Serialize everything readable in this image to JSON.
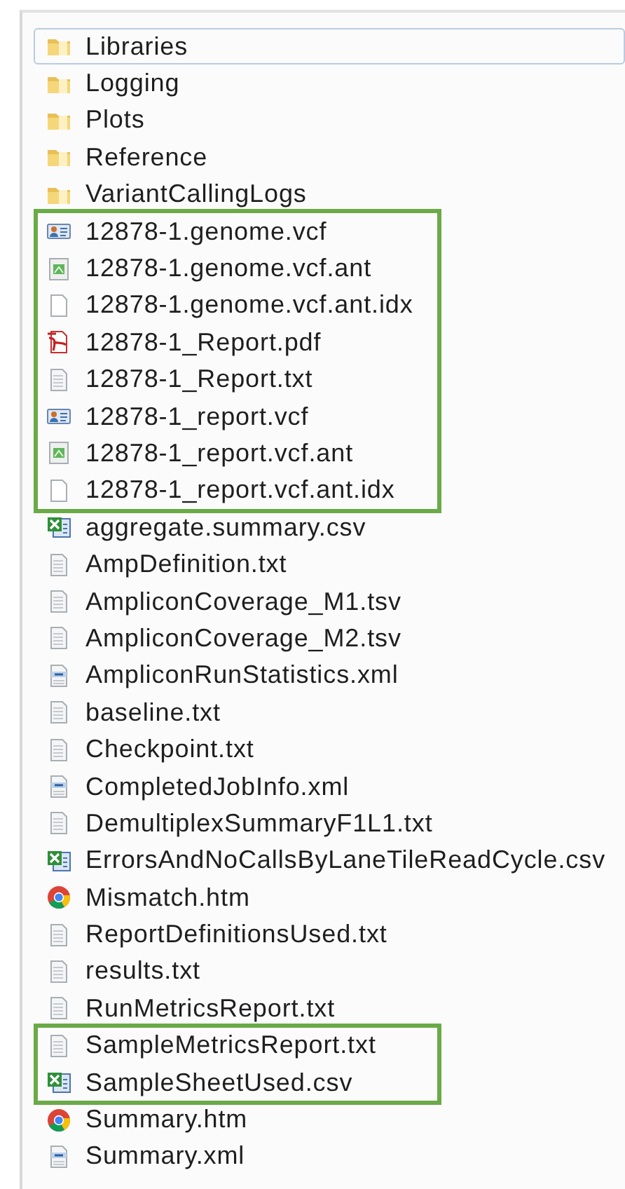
{
  "files": [
    {
      "highlighted": false,
      "items": [
        {
          "name": "Libraries",
          "kind": "folder",
          "focused": true
        },
        {
          "name": "Logging",
          "kind": "folder",
          "focused": false
        },
        {
          "name": "Plots",
          "kind": "folder",
          "focused": false
        },
        {
          "name": "Reference",
          "kind": "folder",
          "focused": false
        },
        {
          "name": "VariantCallingLogs",
          "kind": "folder",
          "focused": false
        }
      ]
    },
    {
      "highlighted": true,
      "items": [
        {
          "name": "12878-1.genome.vcf",
          "kind": "vcf",
          "focused": false
        },
        {
          "name": "12878-1.genome.vcf.ant",
          "kind": "ant",
          "focused": false
        },
        {
          "name": "12878-1.genome.vcf.ant.idx",
          "kind": "blank",
          "focused": false
        },
        {
          "name": "12878-1_Report.pdf",
          "kind": "pdf",
          "focused": false
        },
        {
          "name": "12878-1_Report.txt",
          "kind": "txt",
          "focused": false
        },
        {
          "name": "12878-1_report.vcf",
          "kind": "vcf",
          "focused": false
        },
        {
          "name": "12878-1_report.vcf.ant",
          "kind": "ant",
          "focused": false
        },
        {
          "name": "12878-1_report.vcf.ant.idx",
          "kind": "blank",
          "focused": false
        }
      ]
    },
    {
      "highlighted": false,
      "items": [
        {
          "name": "aggregate.summary.csv",
          "kind": "excel",
          "focused": false
        },
        {
          "name": "AmpDefinition.txt",
          "kind": "txt",
          "focused": false
        },
        {
          "name": "AmpliconCoverage_M1.tsv",
          "kind": "txt",
          "focused": false
        },
        {
          "name": "AmpliconCoverage_M2.tsv",
          "kind": "txt",
          "focused": false
        },
        {
          "name": "AmpliconRunStatistics.xml",
          "kind": "xml",
          "focused": false
        },
        {
          "name": "baseline.txt",
          "kind": "txt",
          "focused": false
        },
        {
          "name": "Checkpoint.txt",
          "kind": "txt",
          "focused": false
        },
        {
          "name": "CompletedJobInfo.xml",
          "kind": "xml",
          "focused": false
        },
        {
          "name": "DemultiplexSummaryF1L1.txt",
          "kind": "txt",
          "focused": false
        },
        {
          "name": "ErrorsAndNoCallsByLaneTileReadCycle.csv",
          "kind": "excel",
          "focused": false
        },
        {
          "name": "Mismatch.htm",
          "kind": "chrome",
          "focused": false
        },
        {
          "name": "ReportDefinitionsUsed.txt",
          "kind": "txt",
          "focused": false
        },
        {
          "name": "results.txt",
          "kind": "txt",
          "focused": false
        },
        {
          "name": "RunMetricsReport.txt",
          "kind": "txt",
          "focused": false
        }
      ]
    },
    {
      "highlighted": true,
      "items": [
        {
          "name": "SampleMetricsReport.txt",
          "kind": "txt",
          "focused": false
        },
        {
          "name": "SampleSheetUsed.csv",
          "kind": "excel",
          "focused": false
        }
      ]
    },
    {
      "highlighted": false,
      "items": [
        {
          "name": "Summary.htm",
          "kind": "chrome",
          "focused": false
        },
        {
          "name": "Summary.xml",
          "kind": "xml",
          "focused": false
        }
      ]
    }
  ]
}
